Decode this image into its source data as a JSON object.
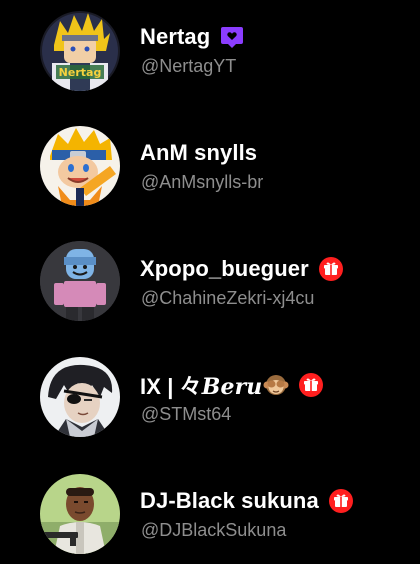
{
  "users": [
    {
      "name": "Nertag",
      "handle": "@NertagYT",
      "badge": "purple-heart-message-icon",
      "avatar": "yellow-hair-anime-character",
      "avatar_text": "Nertag"
    },
    {
      "name": "AnM snylls",
      "handle": "@AnMsnylls-br",
      "badge": null,
      "avatar": "naruto-blue-headband"
    },
    {
      "name": "Xpopo_bueguer",
      "handle": "@ChahineZekri-xj4cu",
      "badge": "red-gift-icon",
      "avatar": "roblox-character-blue-helmet"
    },
    {
      "name_prefix": "IX | ",
      "name_symbol": "々",
      "name_styled": "Beru",
      "handle": "@STMst64",
      "badge": "red-gift-icon",
      "emoji": "see-no-evil-monkey-icon",
      "avatar": "anime-character-eyepatch"
    },
    {
      "name": "DJ-Black sukuna",
      "handle": "@DJBlackSukuna",
      "badge": "red-gift-icon",
      "avatar": "gta-character-green-sky"
    }
  ],
  "colors": {
    "background": "#000000",
    "name": "#ffffff",
    "handle": "#8e8e8e",
    "purple_badge": "#8b3dff",
    "red_badge": "#ff1f1f"
  }
}
